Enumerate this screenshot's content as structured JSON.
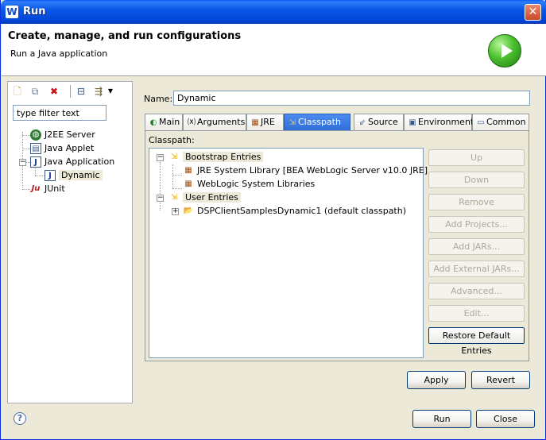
{
  "window": {
    "title": "Run"
  },
  "header": {
    "title": "Create, manage, and run configurations",
    "subtitle": "Run a Java application"
  },
  "left": {
    "filter_placeholder": "type filter text",
    "tree": [
      {
        "label": "J2EE Server",
        "icon": "j2ee-server-icon"
      },
      {
        "label": "Java Applet",
        "icon": "applet-icon"
      },
      {
        "label": "Java Application",
        "icon": "java-app-icon"
      },
      {
        "label": "Dynamic",
        "icon": "java-config-icon",
        "selected": true
      },
      {
        "label": "JUnit",
        "icon": "junit-icon"
      }
    ]
  },
  "name": {
    "label": "Name:",
    "value": "Dynamic"
  },
  "tabs": [
    "Main",
    "Arguments",
    "JRE",
    "Classpath",
    "Source",
    "Environment",
    "Common"
  ],
  "active_tab": "Classpath",
  "classpath": {
    "label": "Classpath:",
    "bootstrap": "Bootstrap Entries",
    "bootstrap_items": [
      "JRE System Library [BEA WebLogic Server v10.0 JRE]",
      "WebLogic System Libraries"
    ],
    "user": "User Entries",
    "user_items": [
      "DSPClientSamplesDynamic1 (default classpath)"
    ]
  },
  "side_buttons": [
    "Up",
    "Down",
    "Remove",
    "Add Projects...",
    "Add JARs...",
    "Add External JARs...",
    "Advanced...",
    "Edit...",
    "Restore Default Entries"
  ],
  "actions": {
    "apply": "Apply",
    "revert": "Revert",
    "run": "Run",
    "close": "Close"
  },
  "colors": {
    "titlebar": "#0A5CF4",
    "selected_tab": "#2E6CD8",
    "panel_bg": "#ECE9D8"
  }
}
